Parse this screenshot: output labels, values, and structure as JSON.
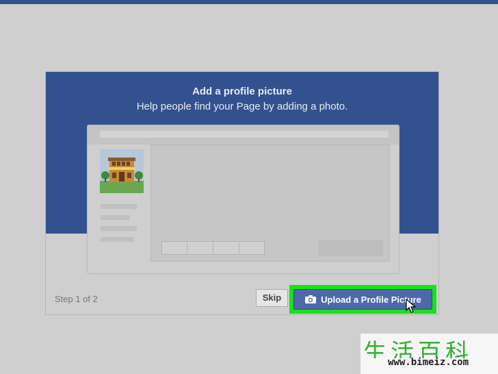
{
  "dialog": {
    "title": "Add a profile picture",
    "subtitle": "Help people find your Page by adding a photo.",
    "step_label": "Step 1 of 2",
    "skip_label": "Skip",
    "upload_label": "Upload a Profile Picture"
  },
  "watermark": {
    "chars": "生活百科",
    "url": "www.bimeiz.com"
  },
  "colors": {
    "brand_blue": "#34518f",
    "button_blue": "#4d69aa",
    "highlight_green": "#17e317",
    "background": "#cfcfcf"
  },
  "icons": [
    "camera-icon",
    "cursor-icon",
    "building-icon"
  ]
}
